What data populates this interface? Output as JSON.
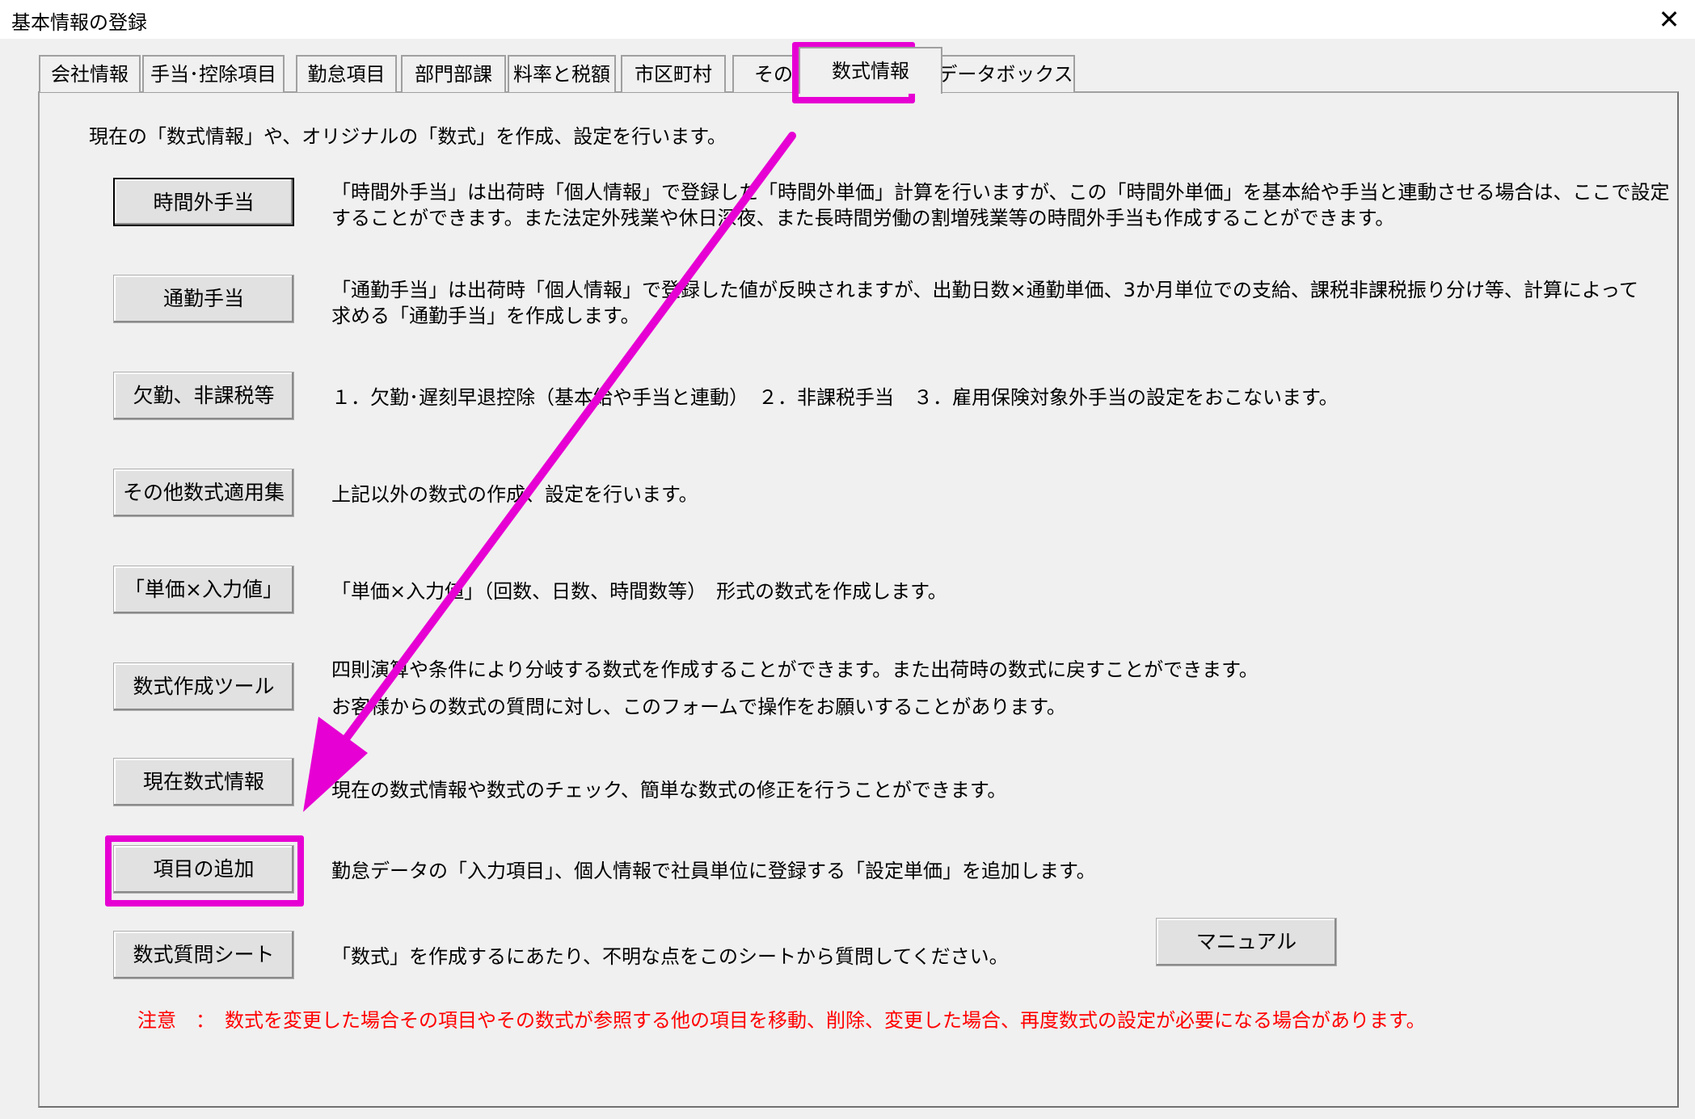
{
  "window": {
    "title": "基本情報の登録",
    "close_icon": "close-icon"
  },
  "tabs": [
    {
      "label": "会社情報",
      "active": false
    },
    {
      "label": "手当･控除項目",
      "active": false
    },
    {
      "label": "勤怠項目",
      "active": false
    },
    {
      "label": "部門部課",
      "active": false
    },
    {
      "label": "料率と税額",
      "active": false
    },
    {
      "label": "市区町村",
      "active": false
    },
    {
      "label": "その他",
      "active": false
    },
    {
      "label": "数式情報",
      "active": true
    },
    {
      "label": "データボックス",
      "active": false
    }
  ],
  "intro": "現在の「数式情報」や、オリジナルの「数式」を作成、設定を行います。",
  "rows": [
    {
      "button": "時間外手当",
      "lines": [
        "「時間外手当」は出荷時「個人情報」で登録した「時間外単価」計算を行いますが、この「時間外単価」を基本給や手当と連動させる場合は、ここで設定",
        "することができます。また法定外残業や休日深夜、また長時間労働の割増残業等の時間外手当も作成することができます。"
      ]
    },
    {
      "button": "通勤手当",
      "lines": [
        "「通勤手当」は出荷時「個人情報」で登録した値が反映されますが、出勤日数×通勤単価、3か月単位での支給、課税非課税振り分け等、計算によって",
        "求める「通勤手当」を作成します。"
      ]
    },
    {
      "button": "欠勤、非課税等",
      "lines": [
        "１．欠勤･遅刻早退控除（基本給や手当と連動）　２．非課税手当　３．雇用保険対象外手当の設定をおこないます。"
      ]
    },
    {
      "button": "その他数式適用集",
      "lines": [
        "上記以外の数式の作成、設定を行います。"
      ]
    },
    {
      "button": "「単価×入力値」",
      "lines": [
        "「単価×入力値」（回数、日数、時間数等）　形式の数式を作成します。"
      ]
    },
    {
      "button": "数式作成ツール",
      "lines": [
        "四則演算や条件により分岐する数式を作成することができます。また出荷時の数式に戻すことができます。",
        "お客様からの数式の質問に対し、このフォームで操作をお願いすることがあります。"
      ]
    },
    {
      "button": "現在数式情報",
      "lines": [
        "現在の数式情報や数式のチェック、簡単な数式の修正を行うことができます。"
      ]
    },
    {
      "button": "項目の追加",
      "lines": [
        "勤怠データの「入力項目」、個人情報で社員単位に登録する「設定単価」を追加します。"
      ]
    },
    {
      "button": "数式質問シート",
      "lines": [
        "「数式」を作成するにあたり、不明な点をこのシートから質問してください。"
      ]
    }
  ],
  "manual_button": "マニュアル",
  "warning": "注意　：　数式を変更した場合その項目やその数式が参照する他の項目を移動、削除、変更した場合、再度数式の設定が必要になる場合があります。",
  "colors": {
    "highlight": "#e600d3",
    "warning": "#ff0000",
    "background": "#f0f0f0"
  }
}
